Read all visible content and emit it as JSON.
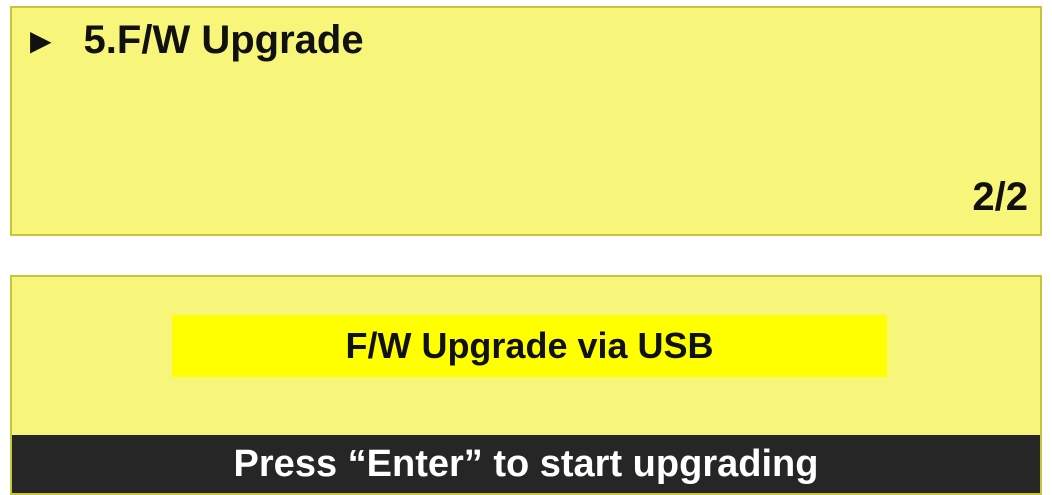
{
  "screen1": {
    "pointer_glyph": "▶",
    "menu_item": "5.F/W Upgrade",
    "page_indicator": "2/2"
  },
  "screen2": {
    "title": "F/W Upgrade via USB",
    "prompt": "Press “Enter” to start upgrading"
  },
  "colors": {
    "lcd_background": "#f7f67a",
    "highlight": "#ffff00",
    "prompt_bar": "#262626",
    "prompt_text": "#ffffff"
  }
}
